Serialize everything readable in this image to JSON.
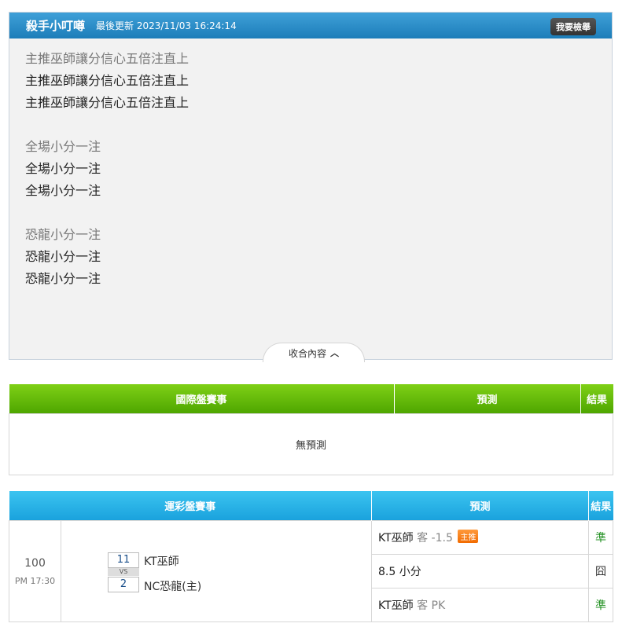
{
  "post": {
    "title": "殺手小叮噂",
    "updated": "最後更新 2023/11/03 16:24:14",
    "report_btn": "我要檢舉",
    "lines": {
      "l1": "主推巫師讓分信心五倍注直上",
      "l2": "主推巫師讓分信心五倍注直上",
      "l3": "主推巫師讓分信心五倍注直上",
      "l4": "全場小分一注",
      "l5": "全場小分一注",
      "l6": "全場小分一注",
      "l7": "恐龍小分一注",
      "l8": "恐龍小分一注",
      "l9": "恐龍小分一注"
    },
    "collapse_label": "收合內容"
  },
  "intl_table": {
    "headers": [
      "國際盤賽事",
      "預測",
      "結果"
    ],
    "empty_text": "無預測"
  },
  "sport_table": {
    "headers": [
      "運彩盤賽事",
      "預測",
      "結果"
    ],
    "match": {
      "number": "100",
      "time": "PM 17:30",
      "away_score": "11",
      "vs": "VS",
      "home_score": "2",
      "away_team": "KT巫師",
      "home_team": "NC恐龍(主)"
    },
    "predictions": [
      {
        "main": "KT巫師",
        "extra": "客 -1.5",
        "badge": "主推",
        "result": "準"
      },
      {
        "main": "8.5 小分",
        "extra": "",
        "badge": "",
        "result": "囧"
      },
      {
        "main": "KT巫師",
        "extra": "客 PK",
        "badge": "",
        "result": "準"
      }
    ]
  },
  "colors": {
    "header_blue": "#1c7db9",
    "intl_green": "#4ea600",
    "sport_blue": "#1aa2dd",
    "hit_green": "#1f8f1f",
    "badge_orange": "#f26b00"
  }
}
